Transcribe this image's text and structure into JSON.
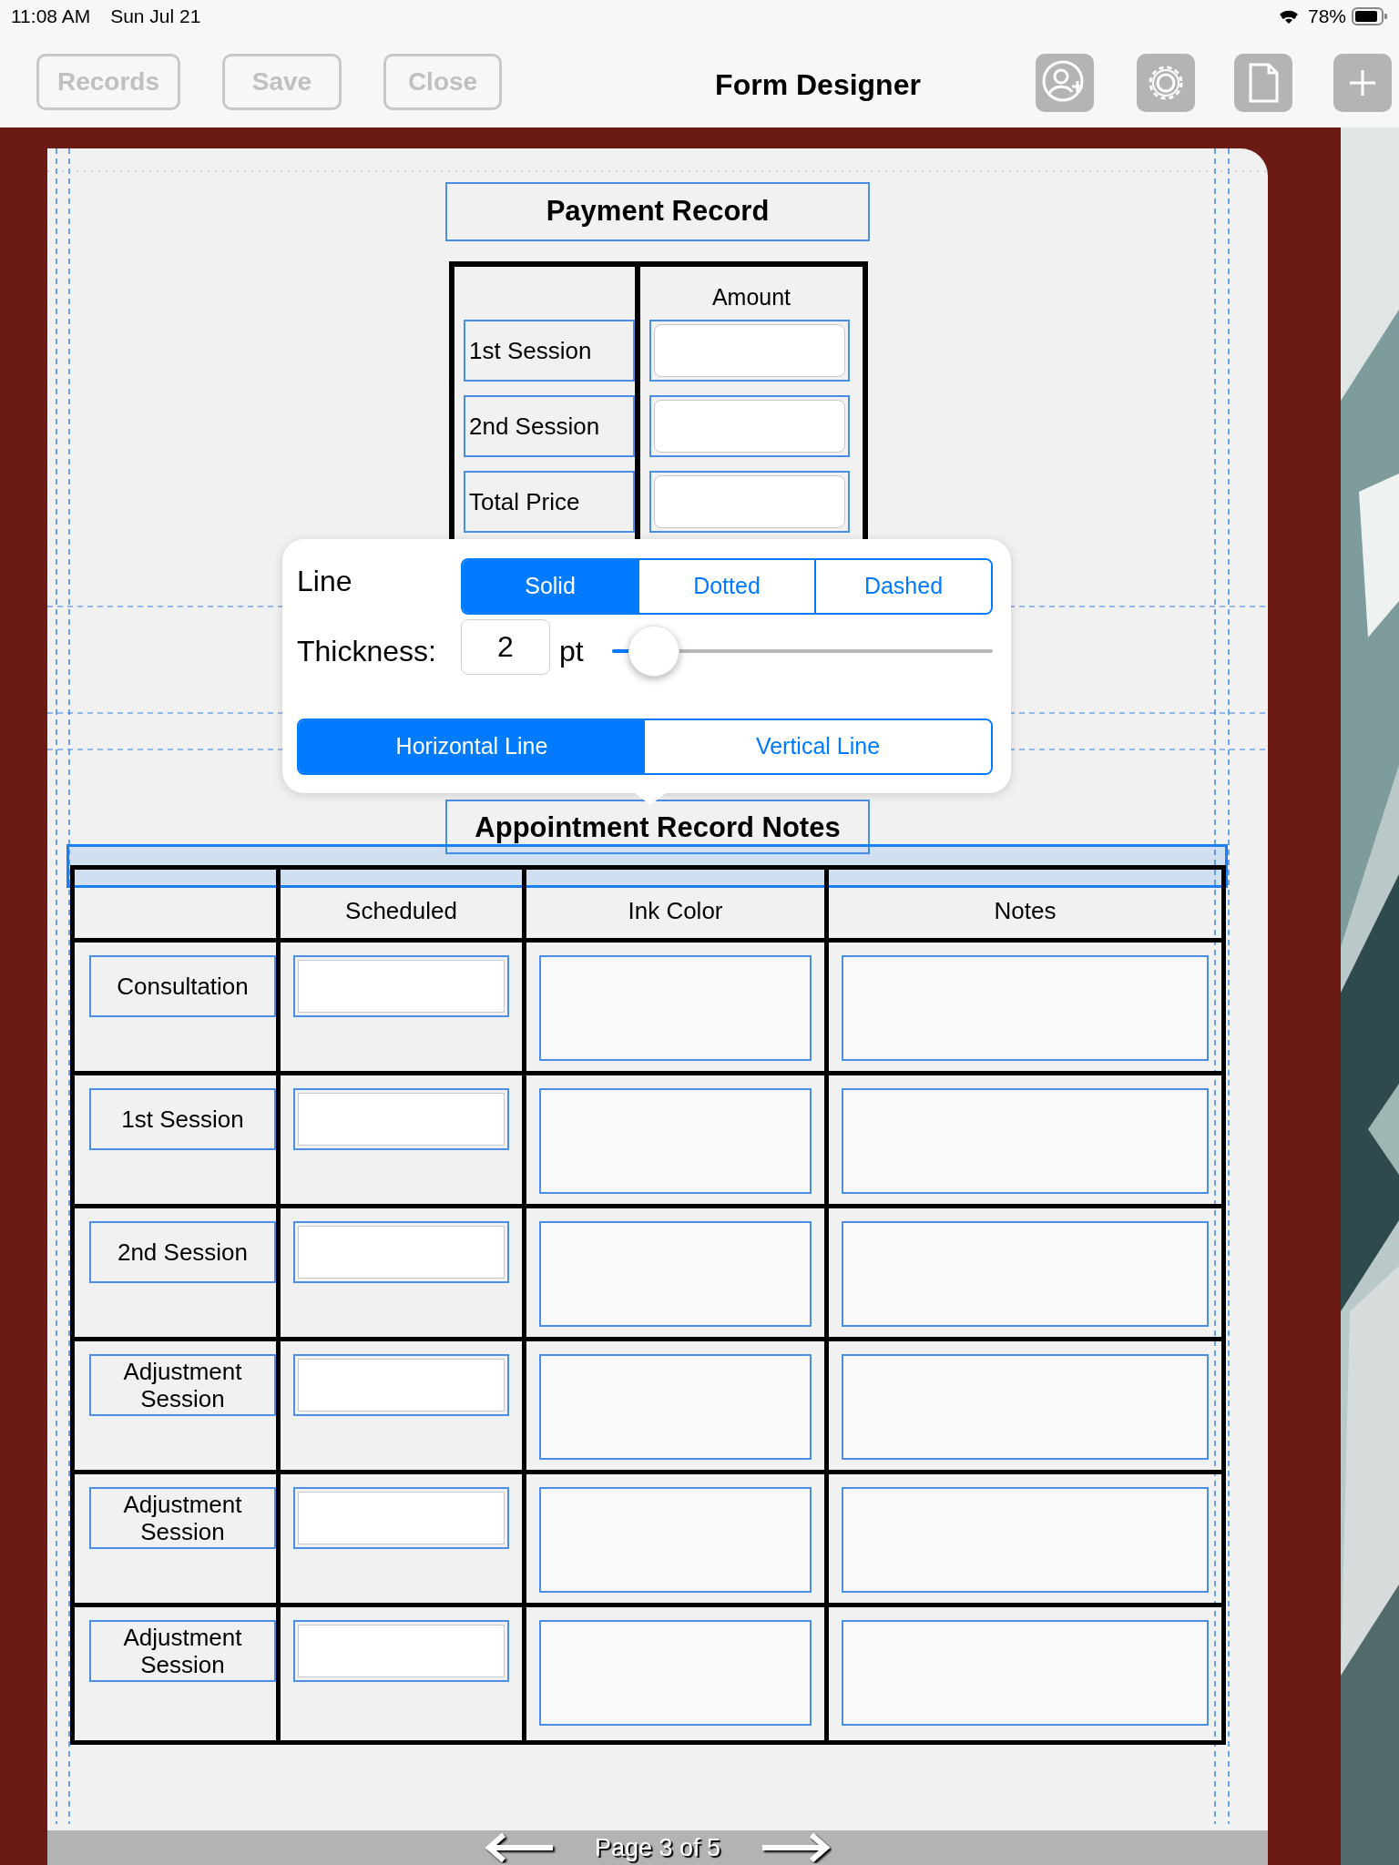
{
  "status_bar": {
    "time": "11:08 AM",
    "date": "Sun Jul 21",
    "battery": "78%"
  },
  "toolbar": {
    "buttons": [
      {
        "label": "Records",
        "disabled": true
      },
      {
        "label": "Save",
        "disabled": true
      },
      {
        "label": "Close",
        "disabled": true
      }
    ],
    "title": "Form Designer",
    "icons": [
      {
        "kind": "add-user"
      },
      {
        "kind": "gear"
      },
      {
        "kind": "document"
      },
      {
        "kind": "plus"
      }
    ]
  },
  "payment_record": {
    "title": "Payment Record",
    "columns": [
      "",
      "Amount"
    ],
    "rows": [
      {
        "label": "1st Session"
      },
      {
        "label": "2nd Session"
      },
      {
        "label": "Total Price"
      }
    ]
  },
  "line_popover": {
    "label": "Line",
    "styles": [
      {
        "label": "Solid",
        "selected": true
      },
      {
        "label": "Dotted",
        "selected": false
      },
      {
        "label": "Dashed",
        "selected": false
      }
    ],
    "thickness_label": "Thickness:",
    "thickness_value": "2",
    "unit": "pt",
    "level": 0.11,
    "orientations": [
      {
        "label": "Horizontal Line",
        "selected": true
      },
      {
        "label": "Vertical Line",
        "selected": false
      }
    ]
  },
  "appointment_notes": {
    "title": "Appointment Record Notes",
    "columns": [
      "",
      "Scheduled",
      "Ink Color",
      "Notes"
    ],
    "rows": [
      {
        "label": "Consultation"
      },
      {
        "label": "1st Session"
      },
      {
        "label": "2nd Session"
      },
      {
        "label": "Adjustment Session"
      },
      {
        "label": "Adjustment Session"
      },
      {
        "label": "Adjustment Session"
      }
    ]
  },
  "pager": {
    "label": "Page 3 of 5"
  }
}
